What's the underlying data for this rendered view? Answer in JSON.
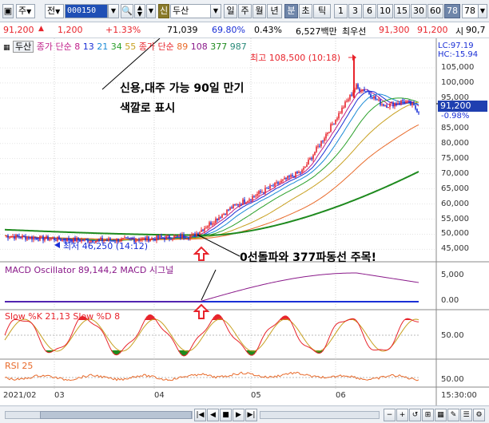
{
  "toolbar": {
    "mode": "주",
    "prev_label": "전",
    "stock_code": "000150",
    "shin_label": "신",
    "stock_name": "두산",
    "periods": [
      "일",
      "주",
      "월",
      "년",
      "분",
      "초",
      "틱"
    ],
    "selected_period": "분",
    "intervals": [
      "1",
      "3",
      "6",
      "10",
      "15",
      "30",
      "60",
      "78"
    ],
    "selected_interval": "78",
    "interval_value": "78"
  },
  "quote": {
    "price": "91,200",
    "change": "1,200",
    "change_pct": "+1.33%",
    "volume": "71,039",
    "vol_ratio": "69.80%",
    "turnover": "0.43%",
    "amount": "6,527백만",
    "top_label": "최우선",
    "bid": "91,300",
    "ask": "91,200",
    "open_label": "시",
    "open_value": "90,7"
  },
  "legend": {
    "name": "두산",
    "close_ma_label": "종가 단순",
    "ma_short": [
      "8",
      "13",
      "21",
      "34",
      "55"
    ],
    "close_ma_label2": "종가 단순",
    "ma_long": [
      "89",
      "108",
      "377",
      "987"
    ],
    "lc": "LC:97.19",
    "hc": "HC:-15.94"
  },
  "annotations": {
    "credit_note_line1": "신용,대주 가능 90일 만기",
    "credit_note_line2": "색깔로 표시",
    "crossover_note": "0선돌파와 377파동선 주목!",
    "high_label": "최고 108,500 (10:18)",
    "low_label": "최저 46,250 (14:12)"
  },
  "price_axis": {
    "current": "91,200",
    "change_pct": "-0.98%",
    "ticks": [
      "105,000",
      "100,000",
      "95,000",
      "85,000",
      "80,000",
      "75,000",
      "70,000",
      "65,000",
      "60,000",
      "55,000",
      "50,000",
      "45,000"
    ]
  },
  "macd": {
    "label": "MACD Oscillator 89,144,2  MACD  시그널",
    "ticks": [
      "5,000",
      "0.00"
    ]
  },
  "slow": {
    "label": "Slow %K 21,13  Slow %D 8",
    "tick": "50.00"
  },
  "rsi": {
    "label": "RSI 25",
    "tick": "50.00"
  },
  "time_axis": {
    "labels": [
      "2021/02",
      "03",
      "04",
      "05",
      "06"
    ],
    "time": "15:30:00"
  },
  "colors": {
    "candle_up": "#e8242c",
    "candle_down": "#1a2fd6",
    "ma_long_green": "#1e8a1e",
    "macd": "#8a1a8a",
    "signal": "#1a2fd6",
    "price_tag": "#1f3fb0"
  },
  "chart_data": {
    "type": "line",
    "ylim": [
      45000,
      110000
    ],
    "key_points": {
      "high": 108500,
      "low": 46250,
      "current": 91200
    }
  }
}
